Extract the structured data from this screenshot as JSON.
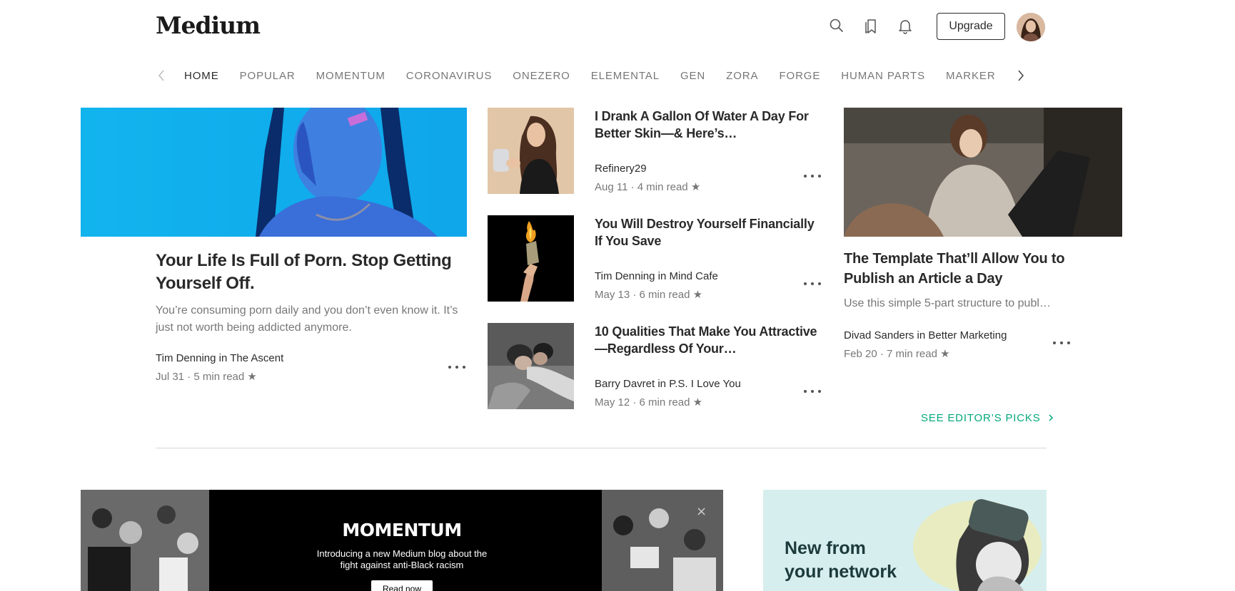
{
  "header": {
    "logo": "Medium",
    "upgrade_label": "Upgrade"
  },
  "icons": {
    "search": "search-icon",
    "bookmarks": "bookmarks-icon",
    "notifications": "bell-icon"
  },
  "nav": {
    "items": [
      "HOME",
      "POPULAR",
      "MOMENTUM",
      "CORONAVIRUS",
      "ONEZERO",
      "ELEMENTAL",
      "GEN",
      "ZORA",
      "FORGE",
      "HUMAN PARTS",
      "MARKER"
    ],
    "active": "HOME"
  },
  "featured": {
    "title": "Your Life Is Full of Porn. Stop Getting Yourself Off.",
    "excerpt": "You’re consuming porn daily and you don’t even know it. It’s just not worth being addicted anymore.",
    "author": "Tim Denning in The Ascent",
    "date": "Jul 31",
    "read_time": "5 min read",
    "star": "★"
  },
  "middle_stories": [
    {
      "title": "I Drank A Gallon Of Water A Day For Better Skin—& Here’s…",
      "author": "Refinery29",
      "date": "Aug 11",
      "read_time": "4 min read",
      "star": "★"
    },
    {
      "title": "You Will Destroy Yourself Financially If You Save",
      "author": "Tim Denning in Mind Cafe",
      "date": "May 13",
      "read_time": "6 min read",
      "star": "★"
    },
    {
      "title": "10 Qualities That Make You Attractive—Regardless Of Your…",
      "author": "Barry Davret in P.S. I Love You",
      "date": "May 12",
      "read_time": "6 min read",
      "star": "★"
    }
  ],
  "right_story": {
    "title": "The Template That’ll Allow You to Publish an Article a Day",
    "excerpt": "Use this simple 5-part structure to publ…",
    "author": "Divad Sanders in Better Marketing",
    "date": "Feb 20",
    "read_time": "7 min read",
    "star": "★"
  },
  "editors_picks": "SEE EDITOR’S PICKS",
  "promo": {
    "title": "MOMENTUM",
    "text": "Introducing a new Medium blog about the fight against anti-Black racism",
    "button": "Read now"
  },
  "network_card": {
    "title_line1": "New from",
    "title_line2": "your network"
  },
  "colors": {
    "accent": "#03a87c",
    "featured_bg": "#1aa8e8",
    "network_bg": "#d7eeee"
  }
}
